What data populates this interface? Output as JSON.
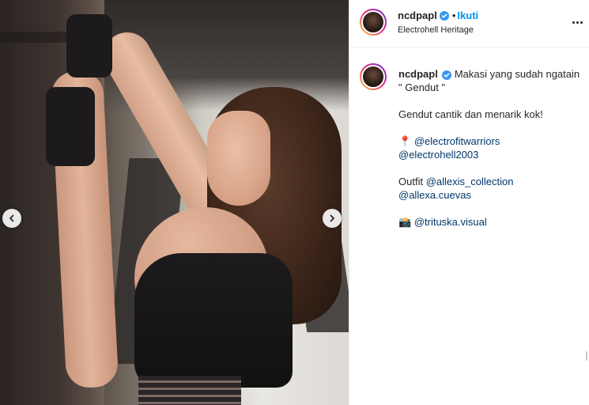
{
  "post": {
    "username": "ncdpapl",
    "verified": true,
    "follow_label": "Ikuti",
    "separator": "•",
    "location": "Electrohell Heritage"
  },
  "caption": {
    "username": "ncdpapl",
    "line1": "Makasi yang sudah ngatain \" Gendut \"",
    "line2": "Gendut cantik dan menarik kok!",
    "pin_emoji": "📍",
    "mention1": "@electrofitwarriors",
    "mention2": "@electrohell2003",
    "outfit_label": "Outfit",
    "mention3": "@allexis_collection",
    "mention4": "@allexa.cuevas",
    "camera_emoji": "📸",
    "mention5": "@trituska.visual"
  },
  "icons": {
    "prev": "chevron-left-icon",
    "next": "chevron-right-icon",
    "more": "more-options-icon",
    "verified": "verified-badge-icon"
  },
  "colors": {
    "accent": "#0095f6",
    "mention": "#00376b",
    "verified": "#3897f0"
  }
}
